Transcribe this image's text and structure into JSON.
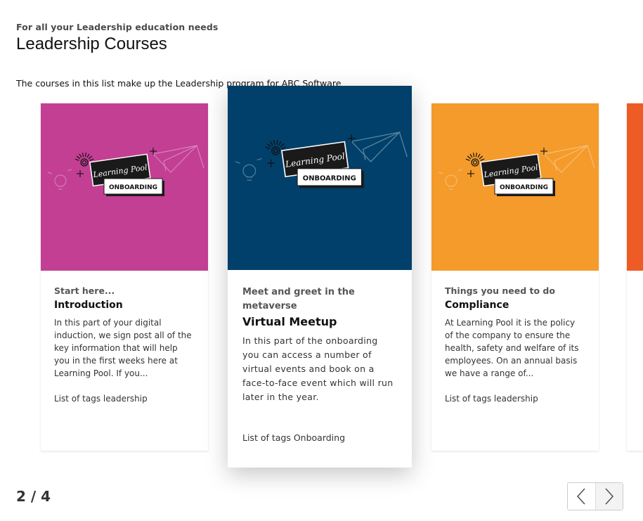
{
  "header": {
    "eyebrow": "For all your Leadership education needs",
    "title": "Leadership Courses",
    "description": "The courses in this list make up the Leadership program for ABC Software"
  },
  "logo": {
    "brand_text": "Learning Pool",
    "badge_text": "ONBOARDING"
  },
  "cards": [
    {
      "subtitle": "Start here...",
      "title": "Introduction",
      "text": "In this part of your digital induction, we sign post all of the key information that will help you in the first weeks here at Learning Pool. If you...",
      "tags": "List of tags leadership",
      "color": "#c23f94"
    },
    {
      "subtitle": "Meet and greet in the metaverse",
      "title": "Virtual Meetup",
      "text": "In this part of the onboarding you can access a number of virtual events and book on a face-to-face event which will run later in the year.",
      "tags": "List of tags Onboarding",
      "color": "#00406b"
    },
    {
      "subtitle": "Things you need to do",
      "title": "Compliance",
      "text": "At Learning Pool it is the policy of the company to ensure the health, safety and welfare of its employees. On an annual basis we have a range of...",
      "tags": "List of tags leadership",
      "color": "#f49b2b"
    },
    {
      "color": "#ee5b25"
    }
  ],
  "pagination": {
    "current": "2 / 4"
  },
  "icons": {
    "prev": "chevron-left-icon",
    "next": "chevron-right-icon"
  }
}
